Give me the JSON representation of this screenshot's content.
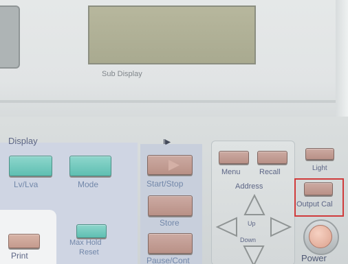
{
  "labels": {
    "sub_display": "Sub Display",
    "display": "Display",
    "play_icon": "II▶",
    "address": "Address",
    "up": "Up",
    "down": "Down",
    "light": "Light",
    "output_cal": "Output Cal",
    "power": "Power"
  },
  "buttons": {
    "lv_lva": "Lv/Lva",
    "mode": "Mode",
    "start_stop": "Start/Stop",
    "store": "Store",
    "pause_cont": "Pause/Cont",
    "menu": "Menu",
    "recall": "Recall",
    "print": "Print",
    "max_hold_reset_line1": "Max Hold",
    "max_hold_reset_line2": "Reset"
  },
  "colors": {
    "highlight_border": "#d03a3a",
    "teal_button": "#7ccfc2",
    "tan_button": "#c8a092"
  }
}
